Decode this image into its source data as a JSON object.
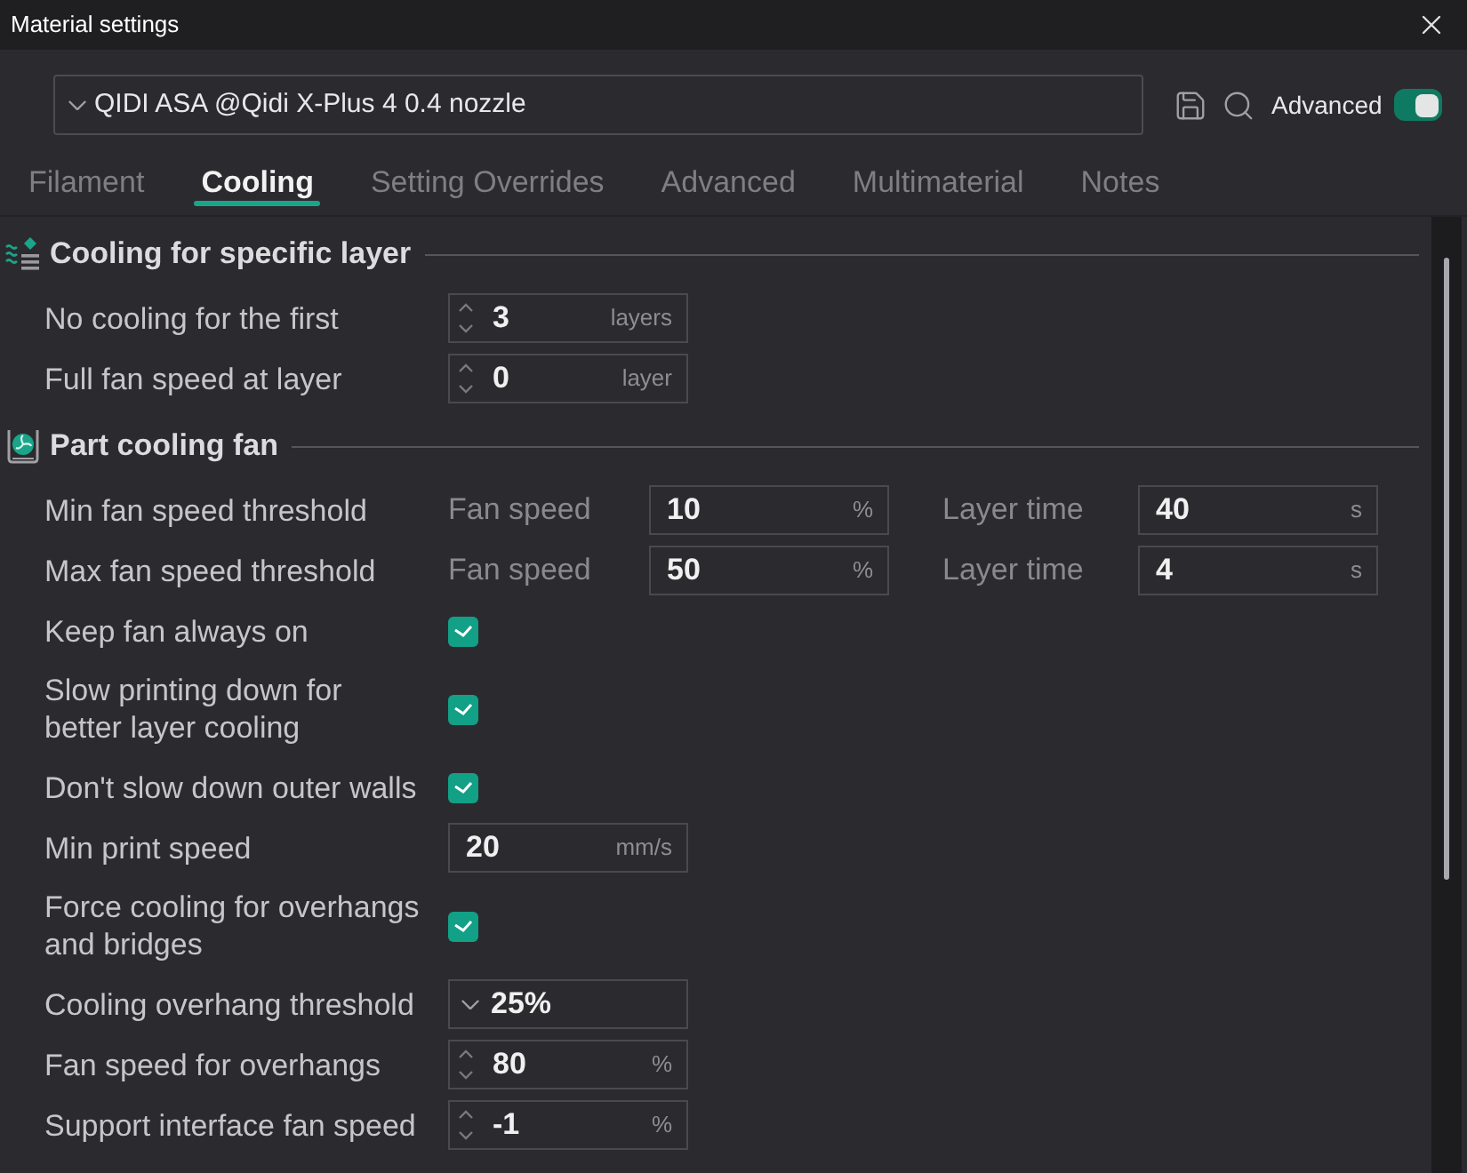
{
  "window": {
    "title": "Material settings"
  },
  "preset_bar": {
    "preset": "QIDI ASA @Qidi X-Plus 4 0.4 nozzle",
    "advanced": {
      "label": "Advanced",
      "on": true
    }
  },
  "tabs": [
    {
      "label": "Filament",
      "selected": false
    },
    {
      "label": "Cooling",
      "selected": true
    },
    {
      "label": "Setting Overrides",
      "selected": false
    },
    {
      "label": "Advanced",
      "selected": false
    },
    {
      "label": "Multimaterial",
      "selected": false
    },
    {
      "label": "Notes",
      "selected": false
    }
  ],
  "sections": [
    {
      "title": "Cooling for specific layer",
      "rows": [
        {
          "kind": "spin",
          "label": "No cooling for the first",
          "value": "3",
          "unit": "layers"
        },
        {
          "kind": "spin",
          "label": "Full fan speed at layer",
          "value": "0",
          "unit": "layer"
        }
      ]
    },
    {
      "title": "Part cooling fan",
      "rows": [
        {
          "kind": "pair",
          "label": "Min fan speed threshold",
          "fields": [
            {
              "label": "Fan speed",
              "value": "10",
              "unit": "%"
            },
            {
              "label": "Layer time",
              "value": "40",
              "unit": "s"
            }
          ]
        },
        {
          "kind": "pair",
          "label": "Max fan speed threshold",
          "fields": [
            {
              "label": "Fan speed",
              "value": "50",
              "unit": "%"
            },
            {
              "label": "Layer time",
              "value": "4",
              "unit": "s"
            }
          ]
        },
        {
          "kind": "check",
          "label": "Keep fan always on",
          "checked": true
        },
        {
          "kind": "check",
          "label": "Slow printing down for better layer cooling",
          "checked": true
        },
        {
          "kind": "check",
          "label": "Don't slow down outer walls",
          "checked": true
        },
        {
          "kind": "text",
          "label": "Min print speed",
          "value": "20",
          "unit": "mm/s"
        },
        {
          "kind": "check",
          "label": "Force cooling for overhangs and bridges",
          "checked": true
        },
        {
          "kind": "combo",
          "label": "Cooling overhang threshold",
          "value": "25%"
        },
        {
          "kind": "spin",
          "label": "Fan speed for overhangs",
          "value": "80",
          "unit": "%"
        },
        {
          "kind": "spin",
          "label": "Support interface fan speed",
          "value": "-1",
          "unit": "%"
        }
      ]
    }
  ]
}
